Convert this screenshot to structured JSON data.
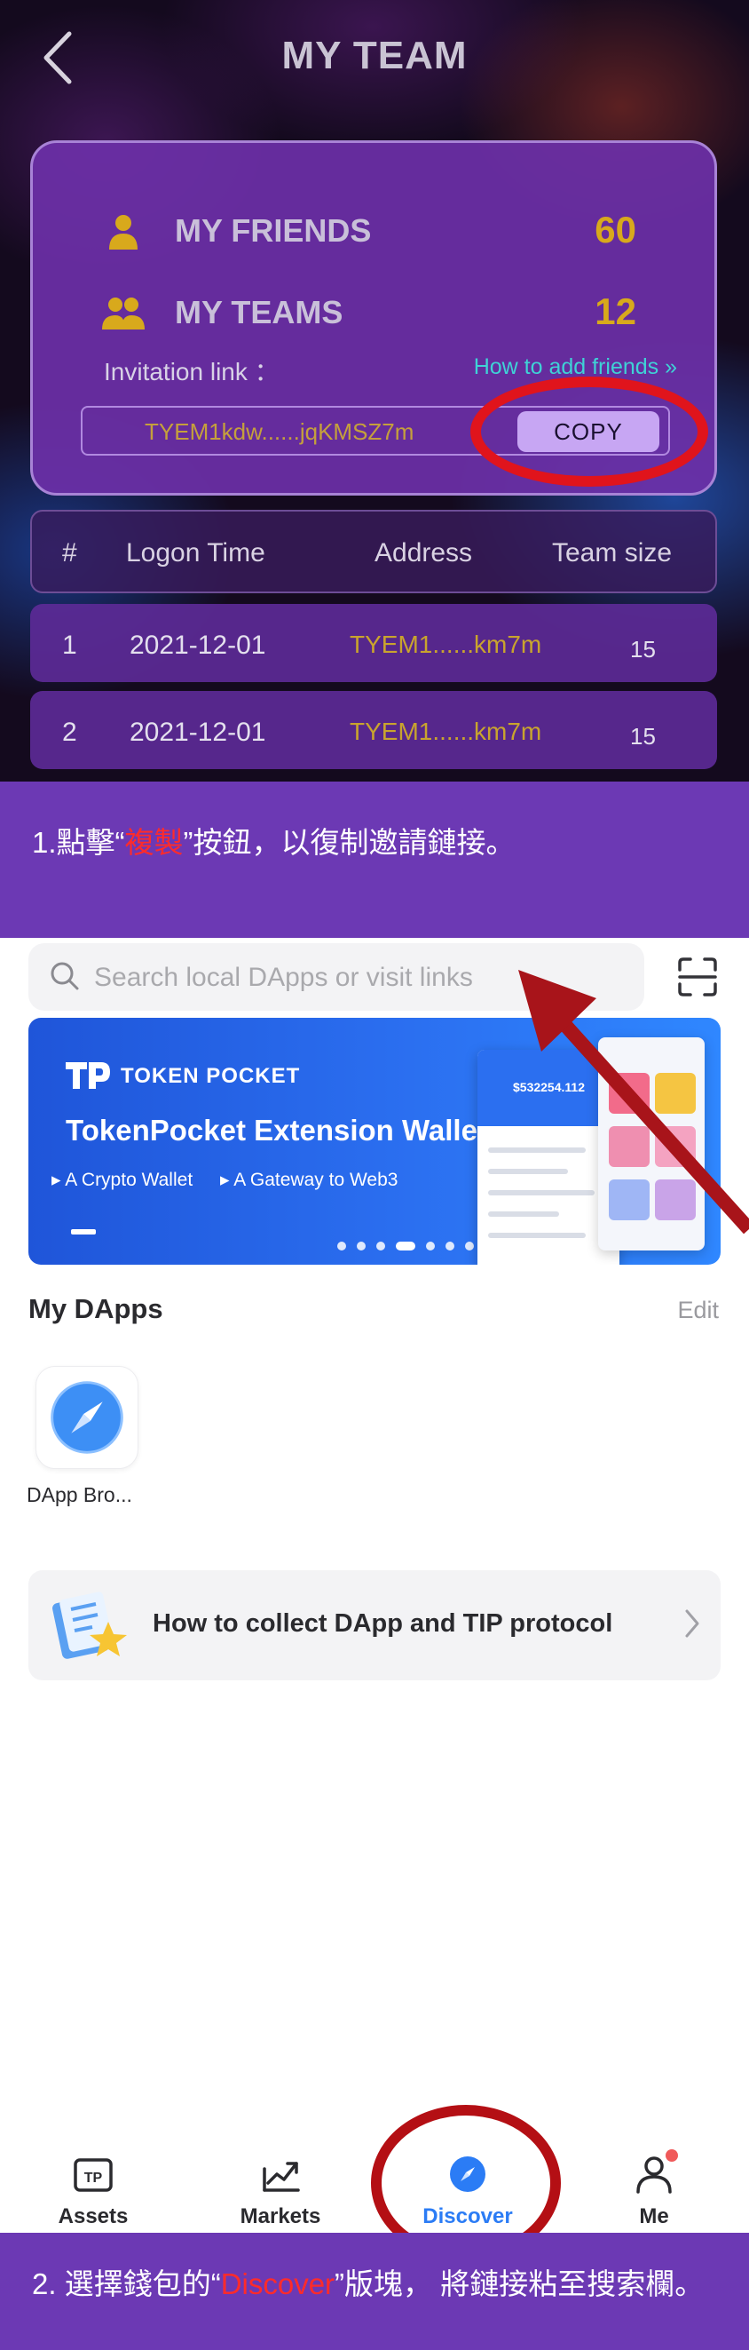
{
  "team": {
    "title": "MY TEAM",
    "friends": {
      "label": "MY FRIENDS",
      "value": "60"
    },
    "teams": {
      "label": "MY TEAMS",
      "value": "12"
    },
    "invitation_label": "Invitation link ：",
    "how_to_add": "How to add friends »",
    "invite_link": "TYEM1kdw......jqKMSZ7m",
    "copy_label": "COPY",
    "table": {
      "headers": [
        "#",
        "Logon Time",
        "Address",
        "Team size"
      ],
      "rows": [
        {
          "index": "1",
          "time": "2021-12-01",
          "address": "TYEM1......km7m",
          "size": "15"
        },
        {
          "index": "2",
          "time": "2021-12-01",
          "address": "TYEM1......km7m",
          "size": "15"
        }
      ]
    }
  },
  "caption1": {
    "prefix": "1.點擊“",
    "highlight": "複製",
    "suffix": "”按鈕，以復制邀請鏈接。"
  },
  "discover": {
    "search_placeholder": "Search local DApps or visit links",
    "banner": {
      "brand": "TOKEN POCKET",
      "title": "TokenPocket Extension Wallet",
      "bullet1": "A Crypto Wallet",
      "bullet2": "A Gateway to Web3",
      "mock_balance": "$532254.112"
    },
    "my_dapps_title": "My DApps",
    "edit_label": "Edit",
    "dapp_name": "DApp Bro...",
    "tip_text": "How to collect DApp and TIP protocol"
  },
  "tabs": [
    {
      "label": "Assets",
      "icon": "tp-wallet-icon"
    },
    {
      "label": "Markets",
      "icon": "chart-icon"
    },
    {
      "label": "Discover",
      "icon": "compass-icon"
    },
    {
      "label": "Me",
      "icon": "person-icon"
    }
  ],
  "caption2": {
    "prefix": "2. 選擇錢包的“",
    "highlight": "Discover",
    "suffix": "”版塊， 將鏈接粘至搜索欄。"
  },
  "colors": {
    "accent_purple": "#6c39b4",
    "gold": "#d8a91c",
    "highlight_red": "#ff2b2b",
    "active_blue": "#2b7cf5"
  }
}
